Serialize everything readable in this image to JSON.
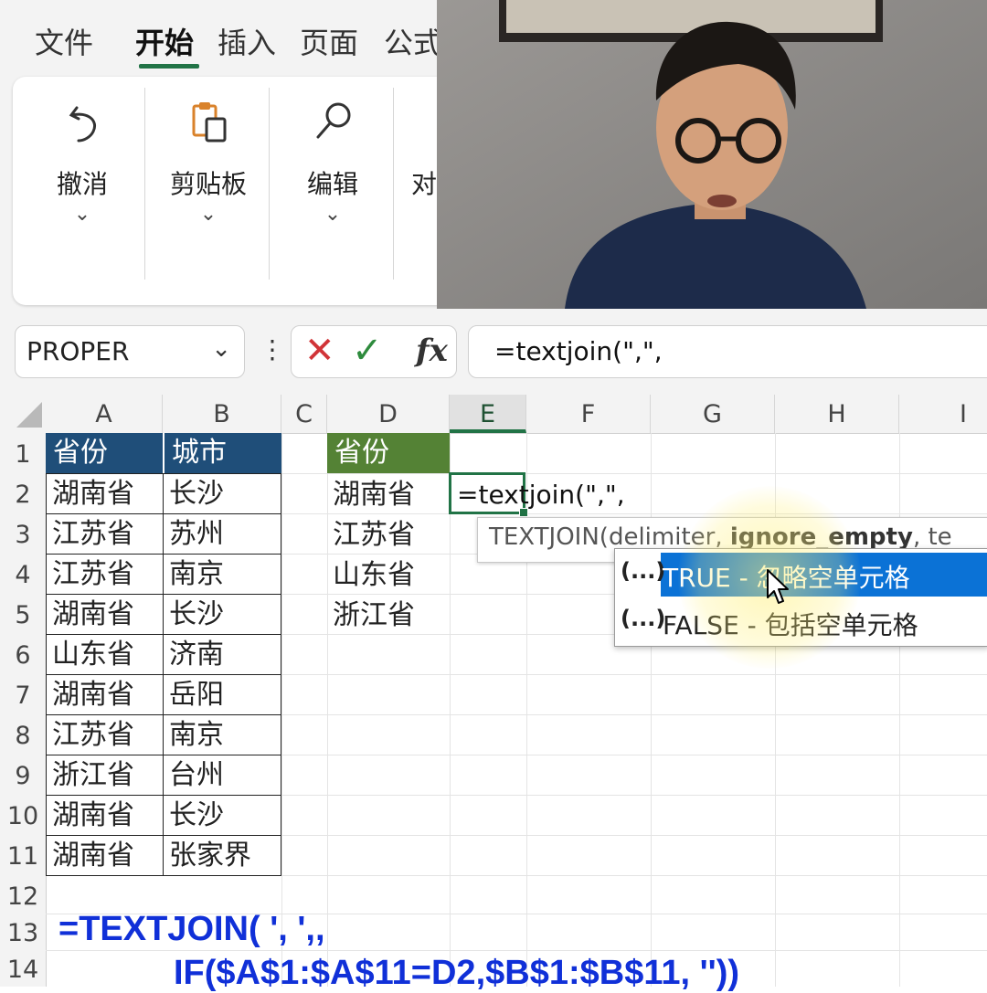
{
  "ribbon": {
    "tabs": [
      "文件",
      "开始",
      "插入",
      "页面",
      "公式"
    ],
    "active_tab": "开始",
    "groups": [
      {
        "label": "撤消",
        "icon": "undo-icon"
      },
      {
        "label": "剪贴板",
        "icon": "clipboard-icon"
      },
      {
        "label": "编辑",
        "icon": "search-icon"
      },
      {
        "label": "对",
        "icon": ""
      }
    ]
  },
  "formula_bar": {
    "name_box": "PROPER",
    "cancel_icon": "✕",
    "enter_icon": "✓",
    "fx_label": "fx",
    "formula": "=textjoin(\",\","
  },
  "grid": {
    "columns": [
      "A",
      "B",
      "C",
      "D",
      "E",
      "F",
      "G",
      "H",
      "I"
    ],
    "selected_column": "E",
    "rows": [
      "1",
      "2",
      "3",
      "4",
      "5",
      "6",
      "7",
      "8",
      "9",
      "10",
      "11",
      "12",
      "13",
      "14"
    ],
    "col_a_header": "省份",
    "col_b_header": "城市",
    "table": [
      [
        "湖南省",
        "长沙"
      ],
      [
        "江苏省",
        "苏州"
      ],
      [
        "江苏省",
        "南京"
      ],
      [
        "湖南省",
        "长沙"
      ],
      [
        "山东省",
        "济南"
      ],
      [
        "湖南省",
        "岳阳"
      ],
      [
        "江苏省",
        "南京"
      ],
      [
        "浙江省",
        "台州"
      ],
      [
        "湖南省",
        "长沙"
      ],
      [
        "湖南省",
        "张家界"
      ]
    ],
    "col_d_header": "省份",
    "col_d_values": [
      "湖南省",
      "江苏省",
      "山东省",
      "浙江省"
    ],
    "active_cell_text": "=textjoin(\",\","
  },
  "autocomplete": {
    "tooltip_prefix": "TEXTJOIN(delimiter, ",
    "tooltip_bold": "ignore_empty",
    "tooltip_suffix": ", te",
    "options": [
      {
        "prefix": "(...)",
        "text": "TRUE - 忽略空单元格"
      },
      {
        "prefix": "(...)",
        "text": "FALSE - 包括空单元格"
      }
    ]
  },
  "annotation": {
    "line1": "=TEXTJOIN( ', ',,",
    "line2": "IF($A$1:$A$11=D2,$B$1:$B$11, ''))"
  },
  "colors": {
    "header_blue": "#1f4e79",
    "header_green": "#548235",
    "highlight": "#0b72d6",
    "annotation": "#1030d8",
    "excel_green": "#217346"
  }
}
